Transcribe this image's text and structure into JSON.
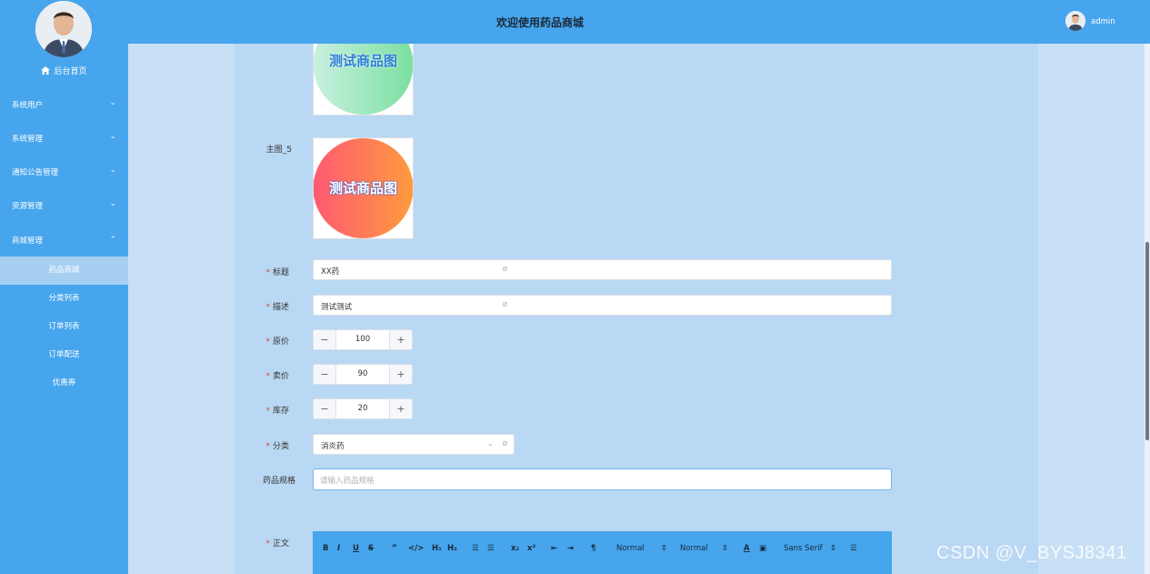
{
  "header": {
    "title": "欢迎使用药品商城",
    "username": "admin"
  },
  "sidebar": {
    "home": "后台首页",
    "menus": [
      {
        "label": "系统用户"
      },
      {
        "label": "系统管理"
      },
      {
        "label": "通知公告管理"
      },
      {
        "label": "资源管理"
      },
      {
        "label": "商城管理"
      }
    ],
    "submenus": [
      {
        "label": "药品商城",
        "active": true
      },
      {
        "label": "分类列表"
      },
      {
        "label": "订单列表"
      },
      {
        "label": "订单配送"
      },
      {
        "label": "优惠券"
      }
    ]
  },
  "form": {
    "image4_text": "测试商品图",
    "main_image5_label": "主图_5",
    "image5_text": "测试商品图",
    "title_label": "标题",
    "title_value": "XX药",
    "desc_label": "描述",
    "desc_value": "测试测试",
    "price_label": "原价",
    "price_value": "100",
    "sale_label": "卖价",
    "sale_value": "90",
    "stock_label": "库存",
    "stock_value": "20",
    "category_label": "分类",
    "category_value": "消炎药",
    "spec_label": "药品规格",
    "spec_placeholder": "请输入药品规格",
    "body_label": "正文"
  },
  "editor": {
    "header_select": "Normal",
    "size_select": "Normal",
    "font_select": "Sans Serif"
  },
  "watermark": "CSDN @V_BYSJ8341"
}
